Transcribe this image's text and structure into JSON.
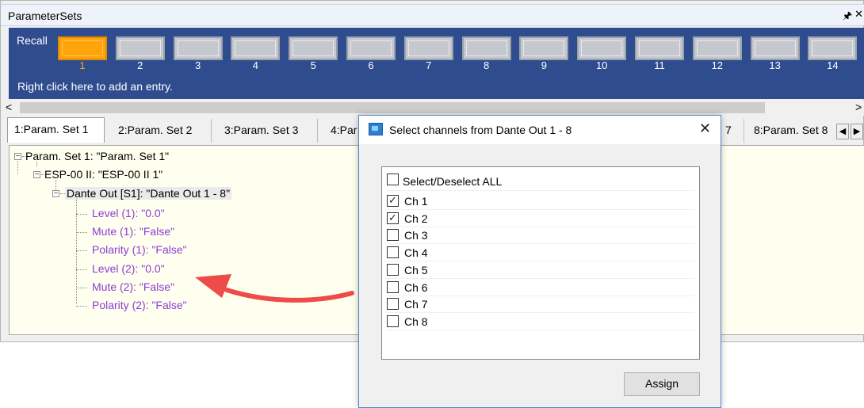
{
  "window": {
    "title": "ParameterSets",
    "pin_icon": "pin-icon",
    "close_icon": "close-icon"
  },
  "recall": {
    "label": "Recall",
    "slots": [
      "1",
      "2",
      "3",
      "4",
      "5",
      "6",
      "7",
      "8",
      "9",
      "10",
      "11",
      "12",
      "13",
      "14"
    ],
    "active_slot": "1",
    "hint": "Right click here to add an entry.",
    "active_color": "#ffa50a",
    "bar_color": "#2f4c8e"
  },
  "scroll": {
    "left_arrow": "<",
    "right_arrow": ">"
  },
  "tabs": [
    "1:Param. Set 1",
    "2:Param. Set 2",
    "3:Param. Set 3",
    "4:Par",
    "7",
    "8:Param. Set 8"
  ],
  "tab_nav": {
    "left": "◀",
    "right": "▶"
  },
  "tree": {
    "root": "Param. Set 1: \"Param. Set 1\"",
    "device": "ESP-00 II: \"ESP-00 II 1\"",
    "block": "Dante Out  [S1]: \"Dante Out 1 - 8\"",
    "leaves": [
      "Level (1): \"0.0\"",
      "Mute (1): \"False\"",
      "Polarity (1): \"False\"",
      "Level (2): \"0.0\"",
      "Mute (2): \"False\"",
      "Polarity (2): \"False\""
    ],
    "leaf_color": "#8c3cd6"
  },
  "dialog": {
    "title": "Select channels from Dante Out 1 - 8",
    "close": "✕",
    "select_all": "Select/Deselect ALL",
    "channels": [
      {
        "label": "Ch 1",
        "checked": true
      },
      {
        "label": "Ch 2",
        "checked": true
      },
      {
        "label": "Ch 3",
        "checked": false
      },
      {
        "label": "Ch 4",
        "checked": false
      },
      {
        "label": "Ch 5",
        "checked": false
      },
      {
        "label": "Ch 6",
        "checked": false
      },
      {
        "label": "Ch 7",
        "checked": false
      },
      {
        "label": "Ch 8",
        "checked": false
      }
    ],
    "assign": "Assign"
  },
  "annotation": {
    "arrow_color": "#f04b4b"
  }
}
